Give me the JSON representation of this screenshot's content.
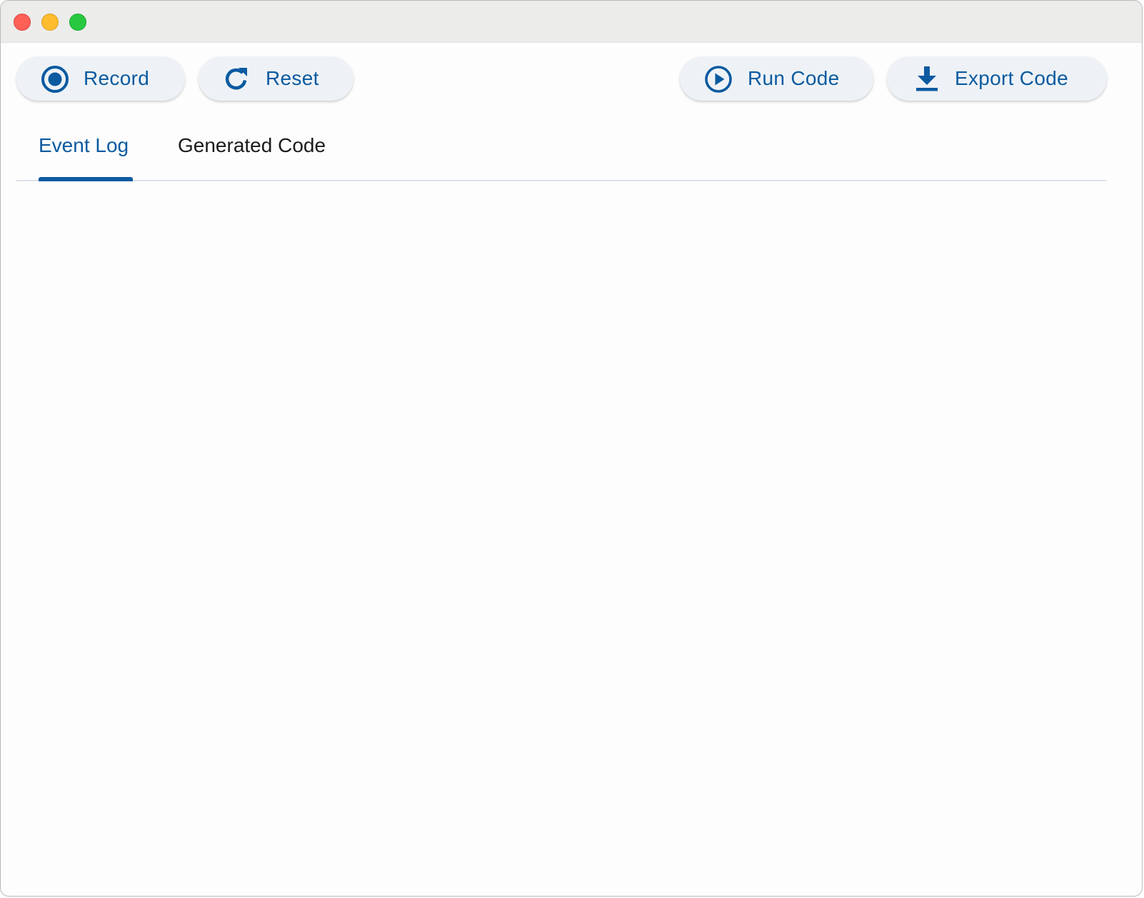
{
  "window": {
    "controls": [
      "close",
      "minimize",
      "zoom"
    ]
  },
  "toolbar": {
    "record_label": "Record",
    "record_icon": "record-circle-icon",
    "reset_label": "Reset",
    "reset_icon": "refresh-icon",
    "run_label": "Run Code",
    "run_icon": "play-circle-icon",
    "export_label": "Export Code",
    "export_icon": "download-icon"
  },
  "tabs": [
    {
      "label": "Event Log",
      "active": true
    },
    {
      "label": "Generated Code",
      "active": false
    }
  ],
  "colors": {
    "accent": "#0b5aa0",
    "button_bg": "#eef2f6",
    "titlebar_bg": "#ececeb"
  }
}
